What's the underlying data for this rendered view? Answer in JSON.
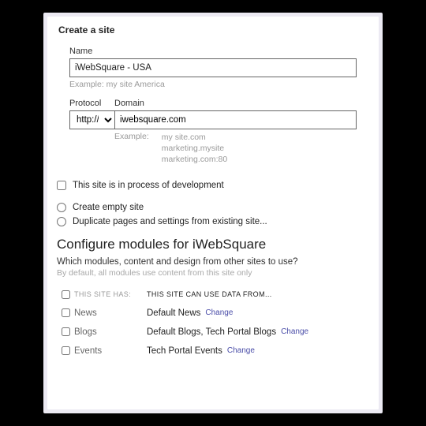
{
  "title": "Create a site",
  "name": {
    "label": "Name",
    "value": "iWebSquare - USA",
    "hint": "Example: my site America"
  },
  "protocol": {
    "label": "Protocol",
    "value": "http://"
  },
  "domain": {
    "label": "Domain",
    "value": "iwebsquare.com",
    "hint_label": "Example:",
    "hint_values": "my site.com\nmarketing.mysite\nmarketing.com:80"
  },
  "dev_checkbox": {
    "label": "This site is in process of development",
    "checked": false
  },
  "radios": {
    "empty": "Create empty site",
    "dup": "Duplicate pages and settings from existing site..."
  },
  "configure": {
    "heading": "Configure modules for iWebSquare",
    "question": "Which modules, content and design from other sites to use?",
    "subtext": "By default, all modules use content from this site only",
    "col_has": "THIS SITE HAS:",
    "col_data": "THIS SITE CAN USE DATA FROM...",
    "change": "Change",
    "rows": [
      {
        "name": "News",
        "data": "Default News"
      },
      {
        "name": "Blogs",
        "data": "Default Blogs, Tech Portal Blogs"
      },
      {
        "name": "Events",
        "data": "Tech Portal Events"
      }
    ]
  }
}
